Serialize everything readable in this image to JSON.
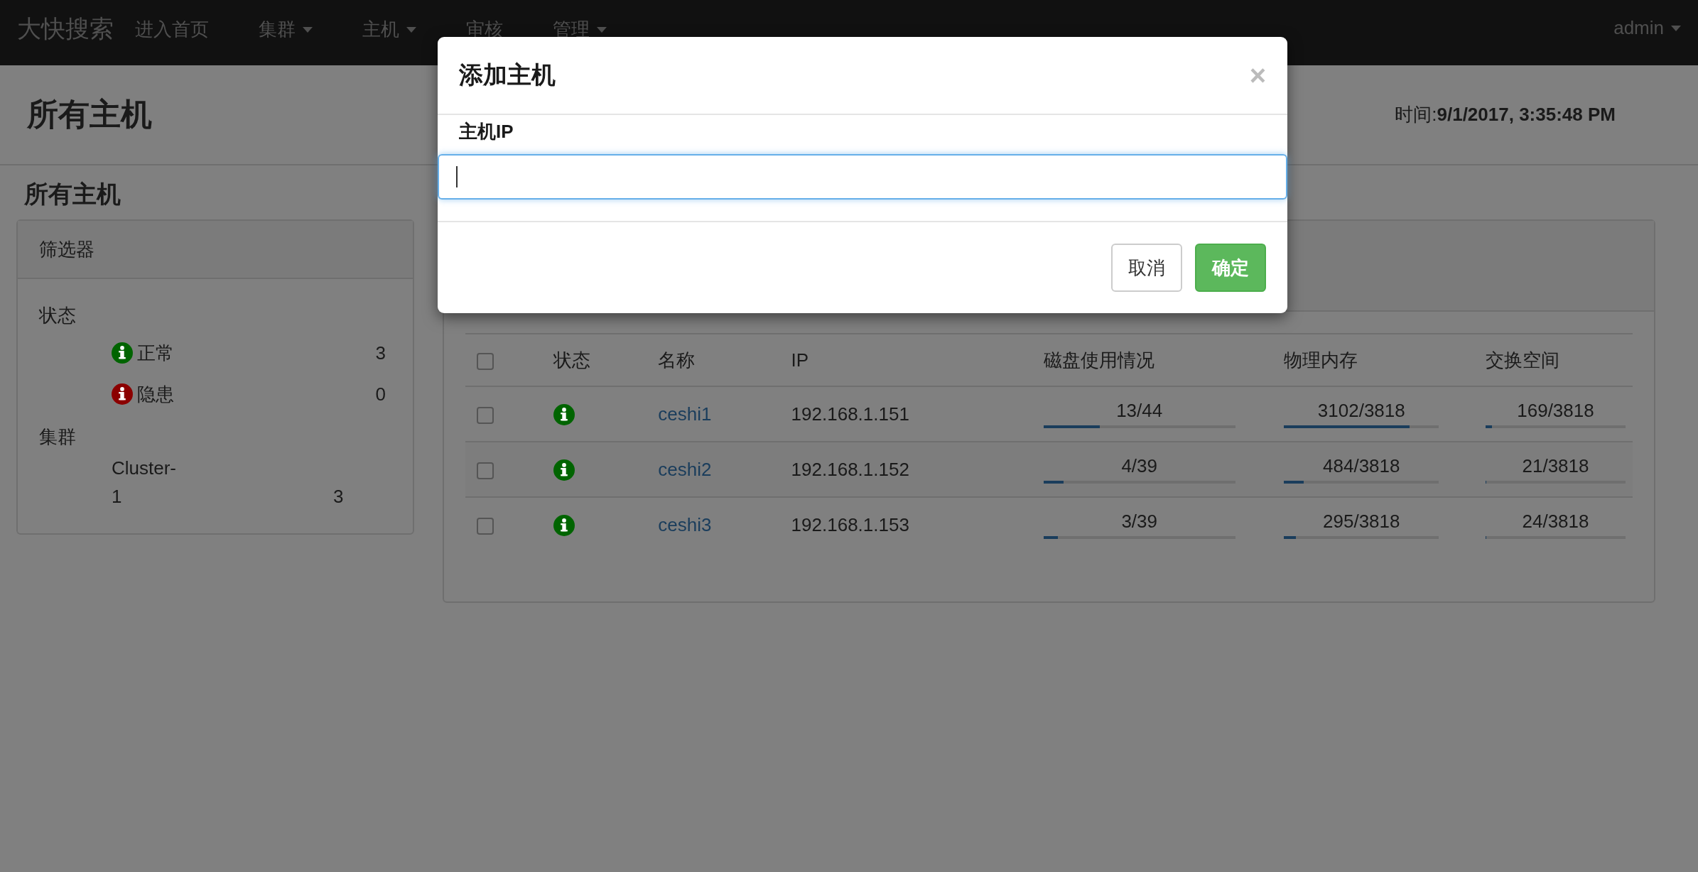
{
  "navbar": {
    "brand": "大快搜索",
    "items": [
      {
        "label": "进入首页",
        "dropdown": false
      },
      {
        "label": "集群",
        "dropdown": true
      },
      {
        "label": "主机",
        "dropdown": true
      },
      {
        "label": "审核",
        "dropdown": false
      },
      {
        "label": "管理",
        "dropdown": true
      }
    ],
    "user": {
      "label": "admin",
      "dropdown": true
    }
  },
  "page_header": {
    "title": "所有主机",
    "time": "时间:**9/1/2017, 3:35:48 PM**"
  },
  "section_title": "所有主机",
  "filter": {
    "title": "筛选器",
    "groups": [
      {
        "kind": "status",
        "label": "状态",
        "items": [
          {
            "label": "正常",
            "count": "3",
            "color": "#006400"
          },
          {
            "label": "隐患",
            "count": "0",
            "color": "#8b0000"
          }
        ]
      },
      {
        "kind": "cluster",
        "label": "集群",
        "items": [
          {
            "label": "Cluster-1",
            "count": "3"
          }
        ]
      }
    ]
  },
  "hosts_table": {
    "select_all": {
      "checked": false
    },
    "columns": [
      "状态",
      "名称",
      "IP",
      "磁盘使用情况",
      "物理内存",
      "交换空间"
    ],
    "rows": [
      {
        "checked": false,
        "color": "#006400",
        "name": "ceshi1",
        "ip": "192.168.1.151",
        "disk": {
          "reading": "13/44",
          "level": 0.295
        },
        "memory": {
          "reading": "3102/3818",
          "level": 0.812
        },
        "swap": {
          "reading": "169/3818",
          "level": 0.044
        }
      },
      {
        "checked": false,
        "color": "#006400",
        "name": "ceshi2",
        "ip": "192.168.1.152",
        "disk": {
          "reading": "4/39",
          "level": 0.103
        },
        "memory": {
          "reading": "484/3818",
          "level": 0.127
        },
        "swap": {
          "reading": "21/3818",
          "level": 0.006
        }
      },
      {
        "checked": false,
        "color": "#006400",
        "name": "ceshi3",
        "ip": "192.168.1.153",
        "disk": {
          "reading": "3/39",
          "level": 0.077
        },
        "memory": {
          "reading": "295/3818",
          "level": 0.077
        },
        "swap": {
          "reading": "24/3818",
          "level": 0.006
        }
      }
    ]
  },
  "modal": {
    "title": "添加主机",
    "close": "×",
    "field_label": "主机IP",
    "focused": true,
    "buttons": [
      {
        "label": "取消",
        "kind": "default"
      },
      {
        "label": "确定",
        "kind": "primary"
      }
    ]
  }
}
